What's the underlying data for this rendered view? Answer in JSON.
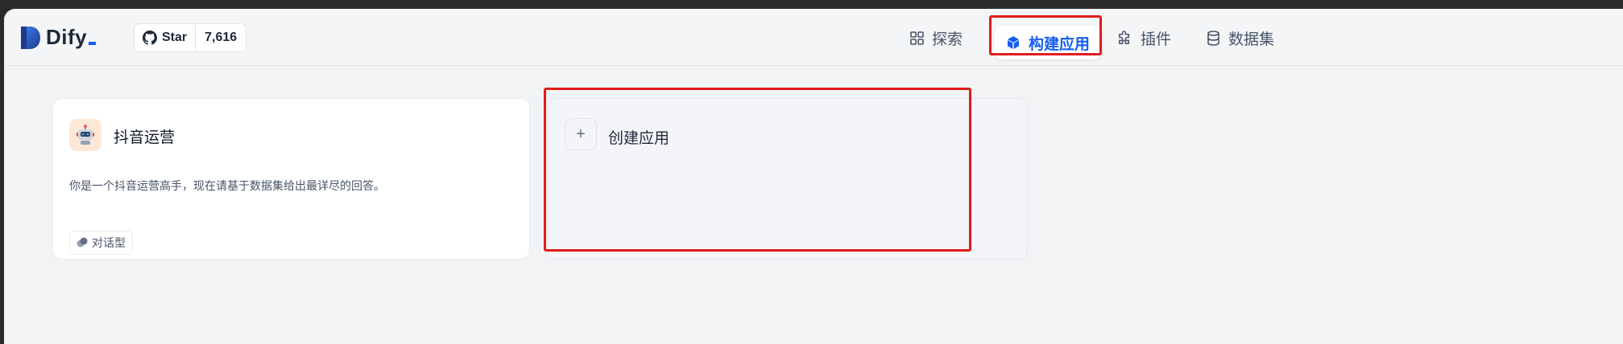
{
  "brand": {
    "name": "Dify",
    "accent": "#155eef"
  },
  "github": {
    "star_label": "Star",
    "star_count": "7,616"
  },
  "nav": {
    "items": [
      {
        "label": "探索",
        "icon": "grid-icon"
      },
      {
        "label": "构建应用",
        "icon": "cube-icon",
        "active": true
      },
      {
        "label": "插件",
        "icon": "puzzle-icon"
      },
      {
        "label": "数据集",
        "icon": "database-icon"
      }
    ]
  },
  "apps": [
    {
      "name": "抖音运营",
      "description": "你是一个抖音运营高手，现在请基于数据集给出最详尽的回答。",
      "type_tag": "对话型",
      "icon": "robot-avatar-icon"
    }
  ],
  "create_app": {
    "label": "创建应用",
    "icon": "plus-icon"
  },
  "highlight_color": "#e01b1b"
}
